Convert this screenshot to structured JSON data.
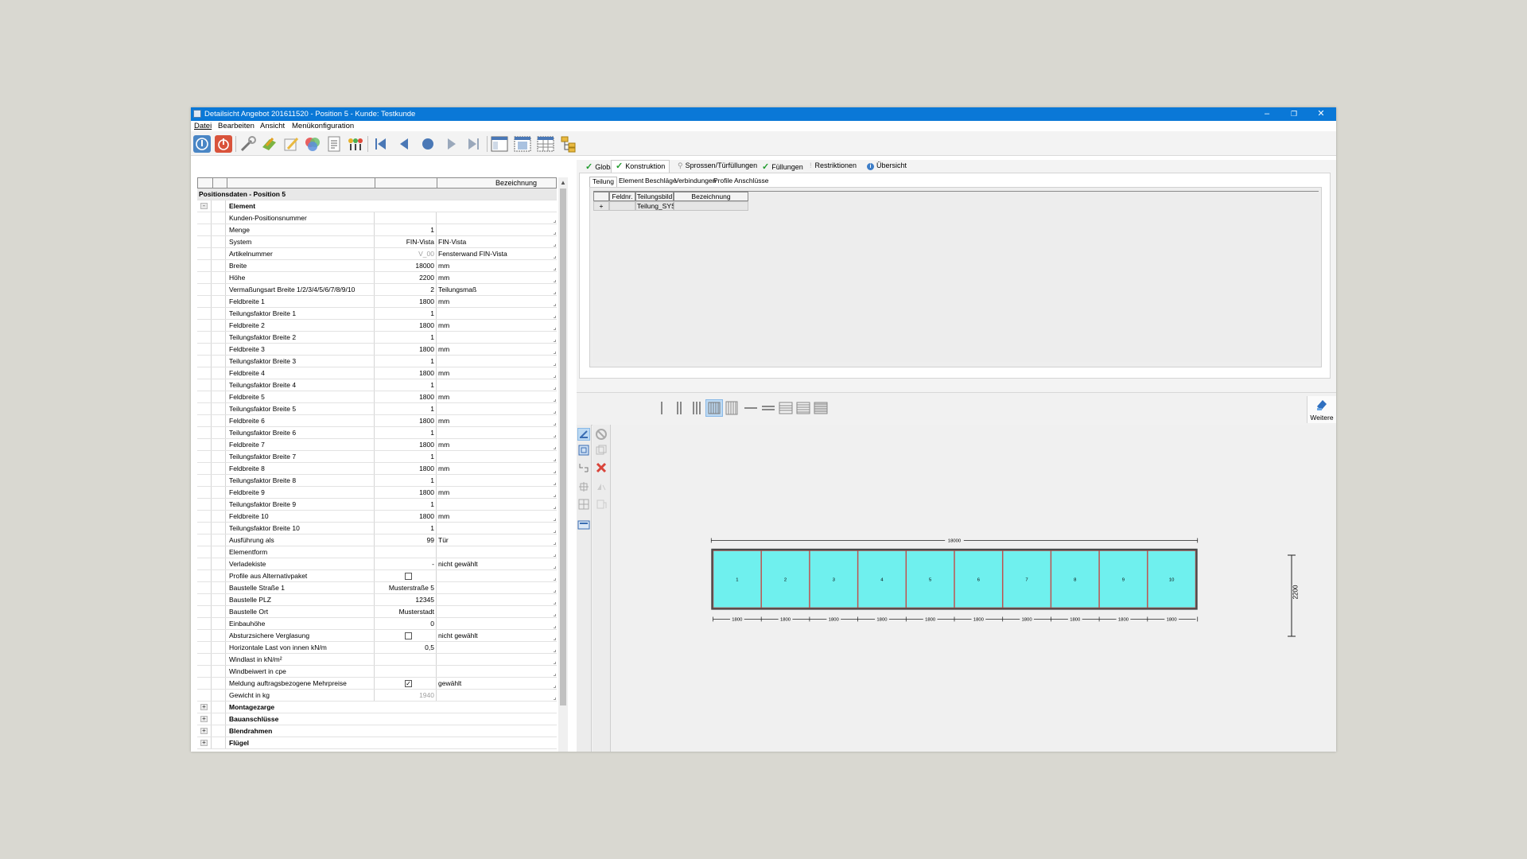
{
  "window": {
    "title": "Detailsicht Angebot 201611520 - Position 5 - Kunde: Testkunde",
    "controls": {
      "minimize": "–",
      "restore": "❐",
      "close": "✕"
    }
  },
  "menu": [
    "Datei",
    "Bearbeiten",
    "Ansicht",
    "Menükonfiguration"
  ],
  "grid": {
    "header_bezeichnung": "Bezeichnung",
    "position_label": "Positionsdaten - Position 5",
    "rows": [
      {
        "name": "Element",
        "value": "",
        "desc": "",
        "type": "group-open"
      },
      {
        "name": "Kunden-Positionsnummer",
        "value": "",
        "desc": ""
      },
      {
        "name": "Menge",
        "value": "1",
        "desc": ""
      },
      {
        "name": "System",
        "value": "FIN-Vista",
        "desc": "FIN-Vista"
      },
      {
        "name": "Artikelnummer",
        "value": "V_00",
        "desc": "Fensterwand FIN-Vista",
        "gray": true
      },
      {
        "name": "Breite",
        "value": "18000",
        "desc": "mm"
      },
      {
        "name": "Höhe",
        "value": "2200",
        "desc": "mm"
      },
      {
        "name": "Vermaßungsart Breite 1/2/3/4/5/6/7/8/9/10",
        "value": "2",
        "desc": "Teilungsmaß"
      },
      {
        "name": "Feldbreite 1",
        "value": "1800",
        "desc": "mm"
      },
      {
        "name": "Teilungsfaktor Breite 1",
        "value": "1",
        "desc": ""
      },
      {
        "name": "Feldbreite 2",
        "value": "1800",
        "desc": "mm"
      },
      {
        "name": "Teilungsfaktor Breite 2",
        "value": "1",
        "desc": ""
      },
      {
        "name": "Feldbreite 3",
        "value": "1800",
        "desc": "mm"
      },
      {
        "name": "Teilungsfaktor Breite 3",
        "value": "1",
        "desc": ""
      },
      {
        "name": "Feldbreite 4",
        "value": "1800",
        "desc": "mm"
      },
      {
        "name": "Teilungsfaktor Breite 4",
        "value": "1",
        "desc": ""
      },
      {
        "name": "Feldbreite 5",
        "value": "1800",
        "desc": "mm"
      },
      {
        "name": "Teilungsfaktor Breite 5",
        "value": "1",
        "desc": ""
      },
      {
        "name": "Feldbreite 6",
        "value": "1800",
        "desc": "mm"
      },
      {
        "name": "Teilungsfaktor Breite 6",
        "value": "1",
        "desc": ""
      },
      {
        "name": "Feldbreite 7",
        "value": "1800",
        "desc": "mm"
      },
      {
        "name": "Teilungsfaktor Breite 7",
        "value": "1",
        "desc": ""
      },
      {
        "name": "Feldbreite 8",
        "value": "1800",
        "desc": "mm"
      },
      {
        "name": "Teilungsfaktor Breite 8",
        "value": "1",
        "desc": ""
      },
      {
        "name": "Feldbreite 9",
        "value": "1800",
        "desc": "mm"
      },
      {
        "name": "Teilungsfaktor Breite 9",
        "value": "1",
        "desc": ""
      },
      {
        "name": "Feldbreite 10",
        "value": "1800",
        "desc": "mm"
      },
      {
        "name": "Teilungsfaktor Breite 10",
        "value": "1",
        "desc": ""
      },
      {
        "name": "Ausführung als",
        "value": "99",
        "desc": "Tür"
      },
      {
        "name": "Elementform",
        "value": "",
        "desc": ""
      },
      {
        "name": "Verladekiste",
        "value": "-",
        "desc": "nicht gewählt"
      },
      {
        "name": "Profile aus Alternativpaket",
        "value": "",
        "desc": "",
        "checkbox": "unchecked"
      },
      {
        "name": "Baustelle Straße 1",
        "value": "Musterstraße 5",
        "desc": ""
      },
      {
        "name": "Baustelle PLZ",
        "value": "12345",
        "desc": ""
      },
      {
        "name": "Baustelle Ort",
        "value": "Musterstadt",
        "desc": ""
      },
      {
        "name": "Einbauhöhe",
        "value": "0",
        "desc": ""
      },
      {
        "name": "Absturzsichere Verglasung",
        "value": "",
        "desc": "nicht gewählt",
        "checkbox": "unchecked"
      },
      {
        "name": "Horizontale Last von innen kN/m",
        "value": "0,5",
        "desc": ""
      },
      {
        "name": "Windlast in kN/m²",
        "value": "",
        "desc": ""
      },
      {
        "name": "Windbeiwert in cpe",
        "value": "",
        "desc": ""
      },
      {
        "name": "Meldung auftragsbezogene Mehrpreise",
        "value": "",
        "desc": "gewählt",
        "checkbox": "checked"
      },
      {
        "name": "Gewicht in kg",
        "value": "1940",
        "desc": "",
        "gray": true
      },
      {
        "name": "Montagezarge",
        "value": "",
        "desc": "",
        "type": "group-closed"
      },
      {
        "name": "Bauanschlüsse",
        "value": "",
        "desc": "",
        "type": "group-closed"
      },
      {
        "name": "Blendrahmen",
        "value": "",
        "desc": "",
        "type": "group-closed"
      },
      {
        "name": "Flügel",
        "value": "",
        "desc": "",
        "type": "group-closed"
      }
    ]
  },
  "tabs": [
    "Global",
    "Konstruktion",
    "Sprossen/Türfüllungen",
    "Füllungen",
    "Restriktionen",
    "Übersicht"
  ],
  "subtabs": [
    "Teilung",
    "Element",
    "Beschläge",
    "Verbindungen",
    "Profile",
    "Anschlüsse"
  ],
  "teilung_table": {
    "headers": [
      "Feldnr.",
      "Teilungsbild",
      "Bezeichnung"
    ],
    "row": {
      "expander": "+",
      "feldnr": "",
      "teilungsbild": "Teilung_SYSTE",
      "bezeichnung": ""
    }
  },
  "weitere_label": "Weitere",
  "drawing": {
    "total_width_label": "18000",
    "height_label": "2200",
    "fields": [
      "1",
      "2",
      "3",
      "4",
      "5",
      "6",
      "7",
      "8",
      "9",
      "10"
    ],
    "field_widths": [
      "1800",
      "1800",
      "1800",
      "1800",
      "1800",
      "1800",
      "1800",
      "1800",
      "1800",
      "1800"
    ],
    "glass_color": "#6ff0ee",
    "mullion_color": "#c0504d"
  }
}
